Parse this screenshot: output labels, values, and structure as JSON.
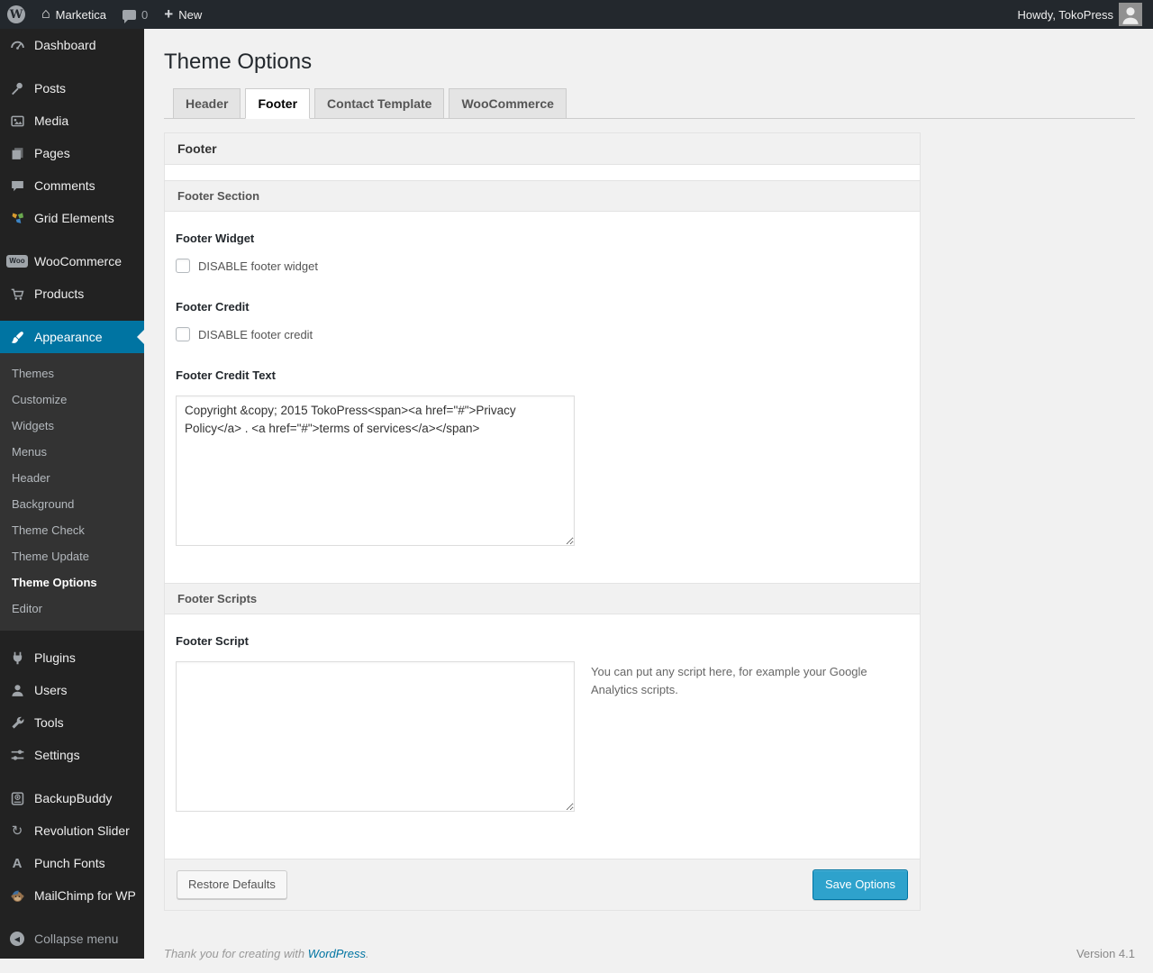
{
  "admin_bar": {
    "site_name": "Marketica",
    "comment_count": "0",
    "new_label": "New",
    "howdy_text": "Howdy, TokoPress"
  },
  "icons": {
    "wp_logo": "W",
    "home": "⌂",
    "plus": "+",
    "woo_badge": "Woo",
    "revolution": "↻",
    "punch_fonts": "A",
    "collapse_arrow": "◀"
  },
  "sidebar": {
    "items": [
      {
        "label": "Dashboard"
      },
      {
        "label": "Posts"
      },
      {
        "label": "Media"
      },
      {
        "label": "Pages"
      },
      {
        "label": "Comments"
      },
      {
        "label": "Grid Elements"
      },
      {
        "label": "WooCommerce"
      },
      {
        "label": "Products"
      },
      {
        "label": "Appearance"
      },
      {
        "label": "Plugins"
      },
      {
        "label": "Users"
      },
      {
        "label": "Tools"
      },
      {
        "label": "Settings"
      },
      {
        "label": "BackupBuddy"
      },
      {
        "label": "Revolution Slider"
      },
      {
        "label": "Punch Fonts"
      },
      {
        "label": "MailChimp for WP"
      }
    ],
    "appearance_submenu": [
      {
        "label": "Themes"
      },
      {
        "label": "Customize"
      },
      {
        "label": "Widgets"
      },
      {
        "label": "Menus"
      },
      {
        "label": "Header"
      },
      {
        "label": "Background"
      },
      {
        "label": "Theme Check"
      },
      {
        "label": "Theme Update"
      },
      {
        "label": "Theme Options"
      },
      {
        "label": "Editor"
      }
    ],
    "collapse_label": "Collapse menu"
  },
  "main": {
    "page_title": "Theme Options",
    "tabs": [
      {
        "label": "Header"
      },
      {
        "label": "Footer"
      },
      {
        "label": "Contact Template"
      },
      {
        "label": "WooCommerce"
      }
    ],
    "panel_title": "Footer",
    "sections": {
      "footer_section_title": "Footer Section",
      "footer_widget_label": "Footer Widget",
      "footer_widget_checkbox": "DISABLE footer widget",
      "footer_credit_label": "Footer Credit",
      "footer_credit_checkbox": "DISABLE footer credit",
      "footer_credit_text_label": "Footer Credit Text",
      "footer_credit_text_value": "Copyright &copy; 2015 TokoPress<span><a href=\"#\">Privacy Policy</a> . <a href=\"#\">terms of services</a></span>",
      "footer_scripts_title": "Footer Scripts",
      "footer_script_label": "Footer Script",
      "footer_script_value": "",
      "footer_script_help": "You can put any script here, for example your Google Analytics scripts."
    },
    "buttons": {
      "restore": "Restore Defaults",
      "save": "Save Options"
    }
  },
  "footer": {
    "thanks_prefix": "Thank you for creating with ",
    "wordpress_link": "WordPress",
    "thanks_suffix": ".",
    "version": "Version 4.1"
  },
  "colors": {
    "accent_blue": "#0074a2",
    "primary_button": "#2ea2cc",
    "admin_dark": "#23282d"
  }
}
